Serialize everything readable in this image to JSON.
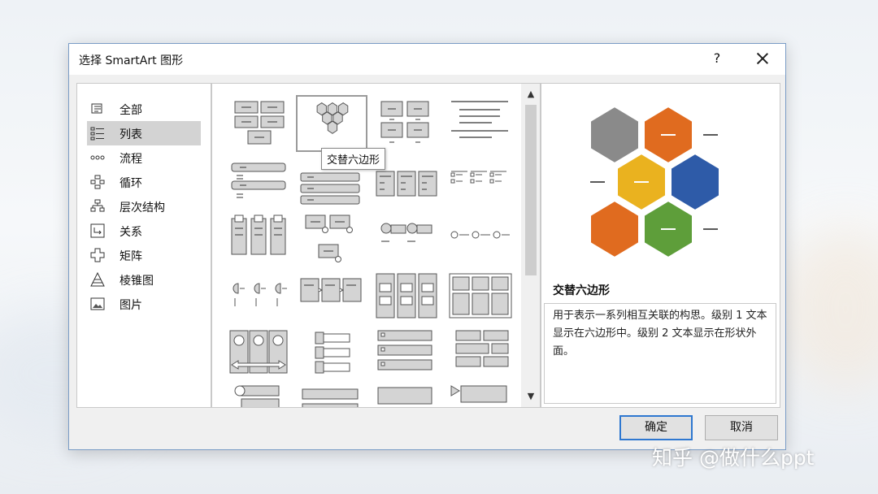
{
  "window": {
    "title": "选择 SmartArt 图形",
    "help_label": "?"
  },
  "categories": [
    {
      "label": "全部",
      "icon": "all-icon"
    },
    {
      "label": "列表",
      "icon": "list-icon",
      "selected": true
    },
    {
      "label": "流程",
      "icon": "process-icon"
    },
    {
      "label": "循环",
      "icon": "cycle-icon"
    },
    {
      "label": "层次结构",
      "icon": "hierarchy-icon"
    },
    {
      "label": "关系",
      "icon": "relationship-icon"
    },
    {
      "label": "矩阵",
      "icon": "matrix-icon"
    },
    {
      "label": "棱锥图",
      "icon": "pyramid-icon"
    },
    {
      "label": "图片",
      "icon": "picture-icon"
    }
  ],
  "gallery": {
    "tooltip": "交替六边形",
    "selected_item": "交替六边形"
  },
  "preview": {
    "title": "交替六边形",
    "description": "用于表示一系列相互关联的构思。级别 1 文本显示在六边形中。级别 2 文本显示在形状外面。",
    "hex_colors": [
      "#8a8a8a",
      "#e06b1f",
      "#eab21f",
      "#2e5ba8",
      "#e06b1f",
      "#5e9e3a"
    ]
  },
  "buttons": {
    "ok": "确定",
    "cancel": "取消"
  },
  "watermark": "知乎 @做什么ppt"
}
